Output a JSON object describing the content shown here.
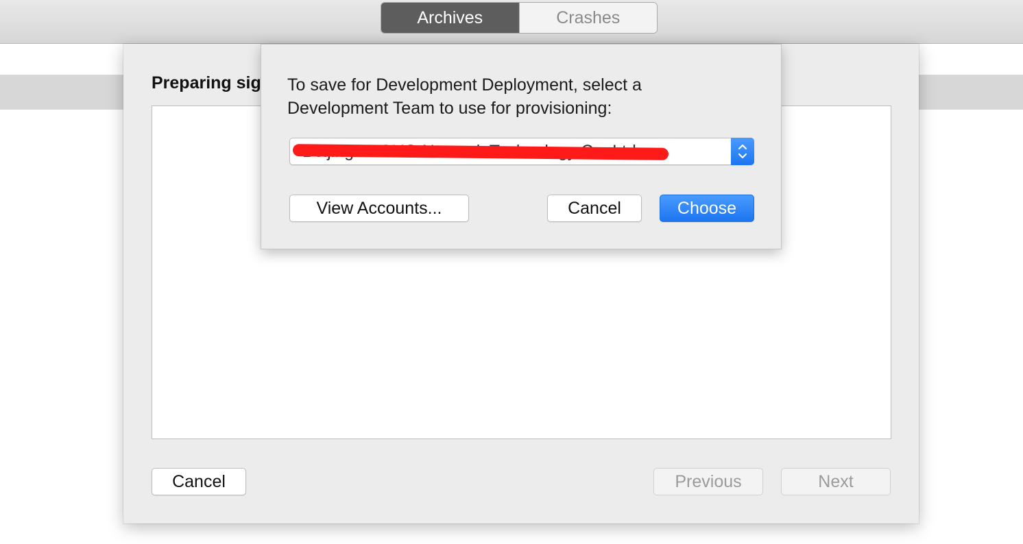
{
  "toolbar": {
    "tabs": [
      {
        "label": "Archives",
        "active": true
      },
      {
        "label": "Crashes",
        "active": false
      }
    ]
  },
  "sheet": {
    "title": "Preparing sig",
    "cancel_label": "Cancel",
    "previous_label": "Previous",
    "next_label": "Next"
  },
  "popover": {
    "message_line1": "To save for Development Deployment, select a",
    "message_line2": "Development Team to use for provisioning:",
    "team_select": {
      "value": "Beijing AYOYO Network Technology Co.,Ltd",
      "redacted": true,
      "icon": "chevron-up-down-icon"
    },
    "view_accounts_label": "View Accounts...",
    "cancel_label": "Cancel",
    "choose_label": "Choose"
  },
  "colors": {
    "accent": "#1c76f0",
    "redaction": "#ff1a1a",
    "active_tab": "#5d5d5d"
  }
}
